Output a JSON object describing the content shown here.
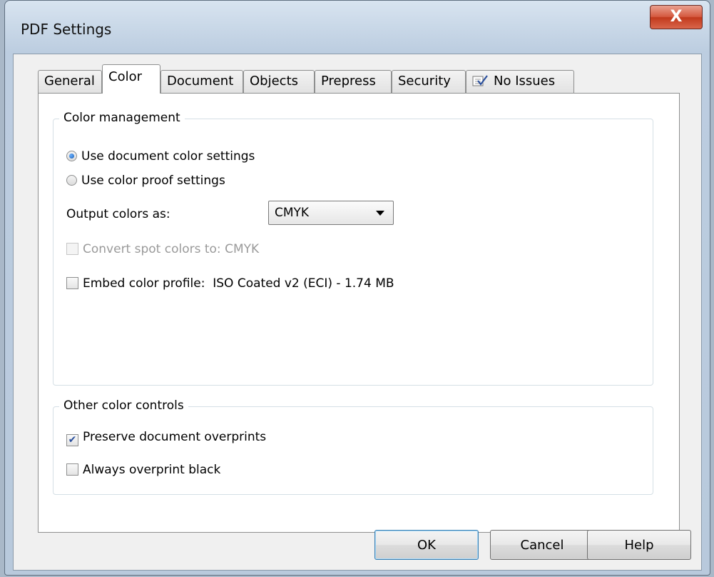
{
  "window": {
    "title": "PDF Settings",
    "close_label": "X"
  },
  "tabs": [
    {
      "label": "General",
      "active": false
    },
    {
      "label": "Color",
      "active": true
    },
    {
      "label": "Document",
      "active": false
    },
    {
      "label": "Objects",
      "active": false
    },
    {
      "label": "Prepress",
      "active": false
    },
    {
      "label": "Security",
      "active": false
    },
    {
      "label": "No Issues",
      "active": false,
      "icon": "checklist-icon"
    }
  ],
  "color_management": {
    "title": "Color management",
    "radio_document": {
      "label": "Use document color settings",
      "selected": true
    },
    "radio_proof": {
      "label": "Use color proof settings",
      "selected": false
    },
    "output_label": "Output colors as:",
    "output_value": "CMYK",
    "convert_spot": {
      "label": "Convert spot colors to:",
      "value": "CMYK",
      "checked": false,
      "enabled": false
    },
    "embed_profile": {
      "label": "Embed color profile:",
      "value": "ISO Coated v2 (ECI) - 1.74 MB",
      "checked": false
    }
  },
  "other_controls": {
    "title": "Other color controls",
    "preserve_overprints": {
      "label": "Preserve document overprints",
      "checked": true
    },
    "always_overprint_black": {
      "label": "Always overprint black",
      "checked": false
    }
  },
  "buttons": {
    "ok": "OK",
    "cancel": "Cancel",
    "help": "Help"
  },
  "colors": {
    "close_red": "#c13a1d",
    "panel_white": "#ffffff",
    "check_blue": "#2a4f9c"
  }
}
